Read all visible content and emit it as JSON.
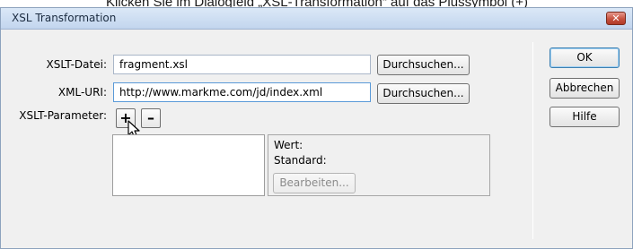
{
  "caption": "Klicken Sie im Dialogfeld „XSL-Transformation“ auf das Plussymbol (+)",
  "window": {
    "title": "XSL Transformation",
    "close_icon": "close-icon",
    "close_glyph": "✕"
  },
  "form": {
    "xslt_label": "XSLT-Datei:",
    "xslt_value": "fragment.xsl",
    "xslt_browse": "Durchsuchen...",
    "xml_label": "XML-URI:",
    "xml_value": "http://www.markme.com/jd/index.xml",
    "xml_browse": "Durchsuchen...",
    "param_label": "XSLT-Parameter:",
    "add_glyph": "+",
    "remove_glyph": "–"
  },
  "details": {
    "wert_label": "Wert:",
    "standard_label": "Standard:",
    "edit_button": "Bearbeiten..."
  },
  "actions": {
    "ok": "OK",
    "cancel": "Abbrechen",
    "help": "Hilfe"
  },
  "colors": {
    "titlebar": "#c2d5ee",
    "close_button": "#c7513f",
    "focus_border": "#5a9ad8"
  },
  "icons": {
    "cursor": "mouse-pointer-icon"
  }
}
